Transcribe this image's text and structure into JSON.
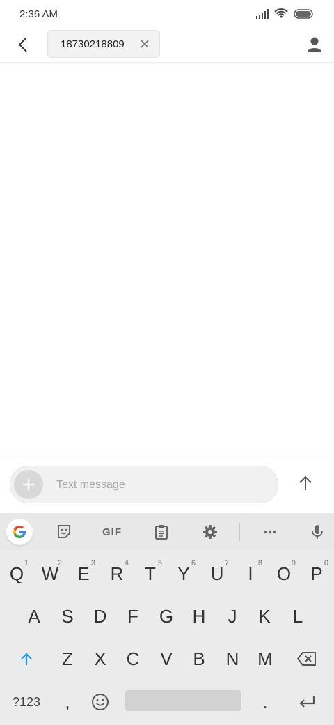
{
  "status_bar": {
    "time": "2:36 AM"
  },
  "header": {
    "recipient": "18730218809"
  },
  "compose": {
    "placeholder": "Text message"
  },
  "keyboard": {
    "toolbar": {
      "gif_label": "GIF"
    },
    "row1": [
      {
        "key": "Q",
        "hint": "1"
      },
      {
        "key": "W",
        "hint": "2"
      },
      {
        "key": "E",
        "hint": "3"
      },
      {
        "key": "R",
        "hint": "4"
      },
      {
        "key": "T",
        "hint": "5"
      },
      {
        "key": "Y",
        "hint": "6"
      },
      {
        "key": "U",
        "hint": "7"
      },
      {
        "key": "I",
        "hint": "8"
      },
      {
        "key": "O",
        "hint": "9"
      },
      {
        "key": "P",
        "hint": "0"
      }
    ],
    "row2": [
      "A",
      "S",
      "D",
      "F",
      "G",
      "H",
      "J",
      "K",
      "L"
    ],
    "row3": [
      "Z",
      "X",
      "C",
      "V",
      "B",
      "N",
      "M"
    ],
    "row4": {
      "mode": "?123",
      "comma": ",",
      "period": "."
    }
  },
  "colors": {
    "accent": "#2196f3",
    "keyboard_bg": "#ebebeb"
  },
  "icons": [
    "back-icon",
    "close-icon",
    "contact-icon",
    "plus-icon",
    "send-arrow-icon",
    "sticker-icon",
    "clipboard-icon",
    "gear-icon",
    "more-icon",
    "mic-icon",
    "shift-icon",
    "backspace-icon",
    "emoji-icon",
    "enter-icon"
  ]
}
